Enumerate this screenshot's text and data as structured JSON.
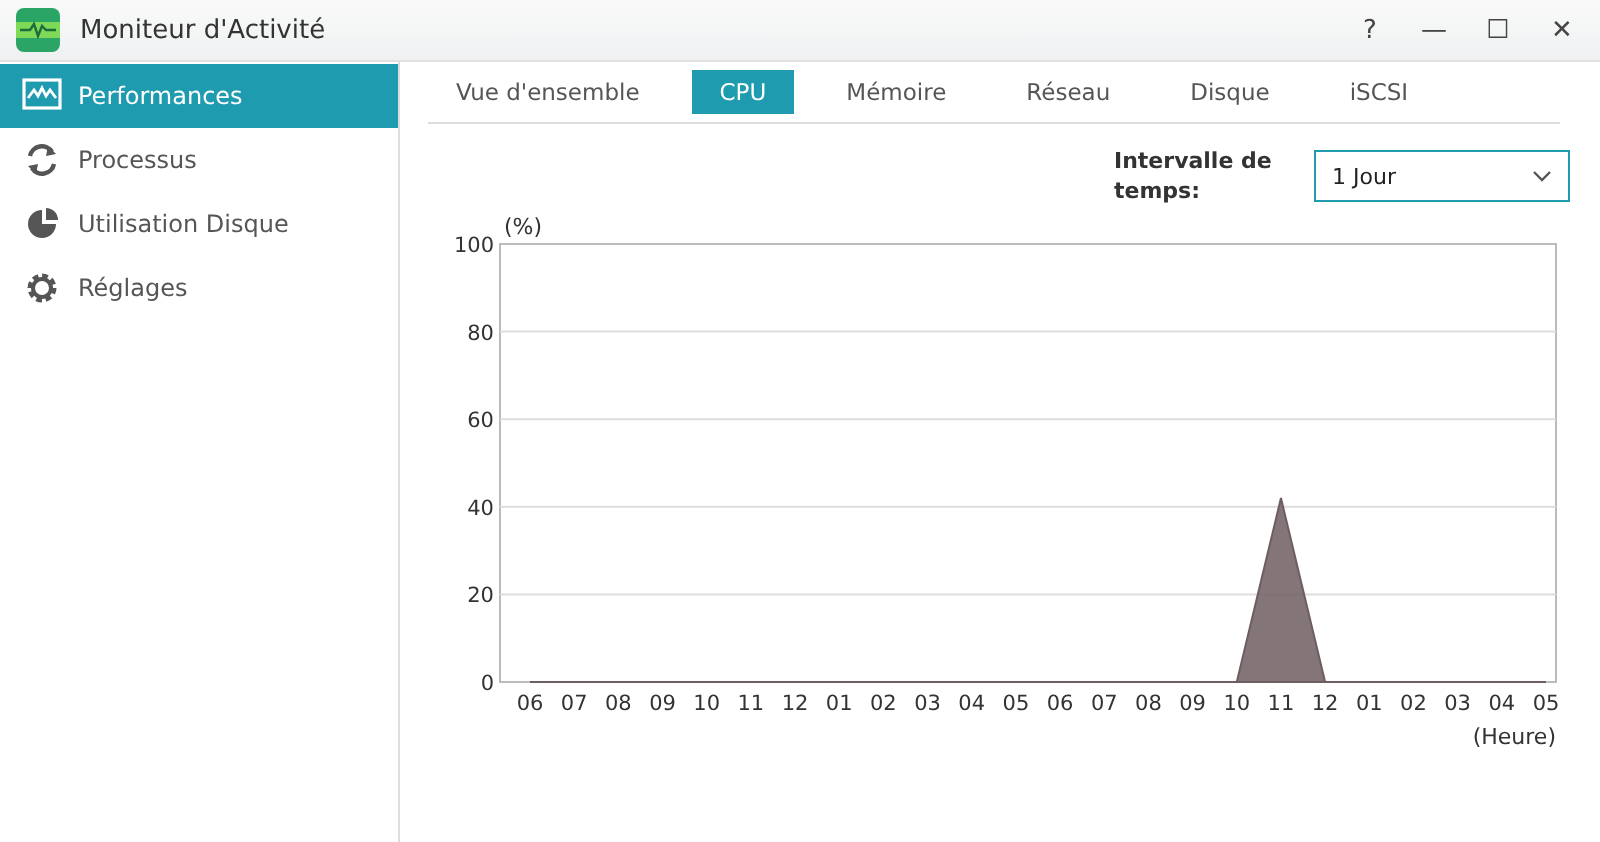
{
  "window": {
    "title": "Moniteur d'Activité",
    "controls": [
      "?",
      "—",
      "☐",
      "✕"
    ]
  },
  "sidebar": {
    "items": [
      {
        "label": "Performances",
        "selected": true
      },
      {
        "label": "Processus",
        "selected": false
      },
      {
        "label": "Utilisation Disque",
        "selected": false
      },
      {
        "label": "Réglages",
        "selected": false
      }
    ]
  },
  "tabs": [
    {
      "label": "Vue d'ensemble",
      "selected": false
    },
    {
      "label": "CPU",
      "selected": true
    },
    {
      "label": "Mémoire",
      "selected": false
    },
    {
      "label": "Réseau",
      "selected": false
    },
    {
      "label": "Disque",
      "selected": false
    },
    {
      "label": "iSCSI",
      "selected": false
    }
  ],
  "interval": {
    "label": "Intervalle de temps:",
    "value": "1 Jour"
  },
  "chart_data": {
    "type": "area",
    "grid": true,
    "ylabel": "(%)",
    "xlabel": "(Heure)",
    "ylim": [
      0,
      100
    ],
    "yticks": [
      0,
      20,
      40,
      60,
      80,
      100
    ],
    "categories": [
      "06",
      "07",
      "08",
      "09",
      "10",
      "11",
      "12",
      "01",
      "02",
      "03",
      "04",
      "05",
      "06",
      "07",
      "08",
      "09",
      "10",
      "11",
      "12",
      "01",
      "02",
      "03",
      "04",
      "05"
    ],
    "series": [
      {
        "color": "#6e5e60",
        "values": [
          0,
          0,
          0,
          0,
          0,
          0,
          0,
          0,
          0,
          0,
          0,
          0,
          0,
          0,
          0,
          0,
          0,
          42,
          0,
          0,
          0,
          0,
          0,
          0
        ]
      }
    ]
  }
}
